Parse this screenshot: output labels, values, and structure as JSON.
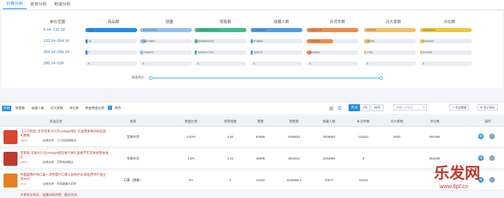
{
  "tabs": [
    "价格分析",
    "类目分析",
    "地域分析"
  ],
  "stats": {
    "headers": [
      "单价范围",
      "商品数",
      "销量",
      "销售额",
      "收藏人数",
      "补货件数",
      "问大家数",
      "评论数"
    ],
    "colors": [
      "#1f8fe6",
      "#8dc3ef",
      "#3bbf8f",
      "#4aa0e0",
      "#f08a4b",
      "#f5c063",
      "#f3c53a"
    ],
    "rows": [
      {
        "range": "0.14~132.14",
        "values": [
          "708",
          "114422318",
          "101986677401.5",
          "17668380",
          "14801175",
          "369910",
          "48380644"
        ],
        "pct": [
          1,
          1,
          1,
          1,
          1,
          1,
          1
        ]
      },
      {
        "range": "132.14~264.14",
        "values": [
          "10",
          "11674860",
          "545583824.5",
          "673850",
          "7716470",
          "45761",
          "3591533"
        ],
        "pct": [
          0.02,
          0.12,
          0.06,
          0.04,
          0.52,
          0.12,
          0.07
        ]
      },
      {
        "range": "264.14~396.14",
        "values": [
          "7",
          "7334572",
          "159519774.9",
          "154770",
          "1542644",
          "1761",
          "591853"
        ],
        "pct": [
          0.01,
          0.06,
          0.02,
          0.01,
          0.1,
          0.005,
          0.01
        ]
      },
      {
        "range": "396.14~520",
        "values": [
          "0",
          "0",
          "0",
          "0",
          "0",
          "0",
          "0"
        ],
        "pct": [
          0,
          0,
          0,
          0,
          0,
          0,
          0
        ]
      }
    ],
    "slider_label": "商品单价"
  },
  "toolbar": {
    "filters": [
      "热销",
      "销量数",
      "收藏人数",
      "问大家数",
      "评论数",
      "佣金佣金比例"
    ],
    "active_filter": 0,
    "sort_label": "降序",
    "ranges": [
      "昨日",
      "7天",
      "30天"
    ],
    "active_range": 0,
    "search_placeholder": "请输入关键词",
    "export_label": "导出数据",
    "fields_label": "显示指标"
  },
  "table": {
    "columns": [
      "商品信息",
      "类目",
      "佣金比例",
      "周转指数",
      "销量",
      "销售额",
      "收藏人数",
      "补货件数",
      "问大家数",
      "评论数",
      "操作"
    ],
    "rows": [
      {
        "thumb": "#d9452f",
        "title": "【三只松鼠_年货坚果大礼包1498g/8袋】礼盒零食休闲食品送礼整箱",
        "price": "168.0",
        "shop": "店铺名称：三只松鼠旗舰店",
        "cells": [
          "坚果炒货",
          "4.51%",
          "4.92",
          "82585",
          "9165601",
          "3048862",
          "131511",
          "4520",
          "694186"
        ]
      },
      {
        "thumb": "#c0392b",
        "title": "百草味-坚果大礼包1600g/9袋坚果干果礼盒春节年货休闲零食送礼",
        "price": "188.0",
        "shop": "店铺名称：百草味旗舰店",
        "cells": [
          "坚果炒货",
          "4.5%",
          "4.41",
          "45898",
          "4911912",
          "2164989",
          "0",
          "",
          "563188"
        ]
      },
      {
        "thumb": "#e67e22",
        "title": "界面面两外粉口喜一次性面片口罩三层防护(k)非医用单片独立装50只",
        "price": "19.9",
        "shop": "店铺名称：阿里健康大药房",
        "cells": [
          "口罩（健康）",
          "0%",
          "0",
          "41297",
          "1045969.3",
          "75577",
          "43443",
          "",
          ""
        ]
      }
    ],
    "tail_title": "大希布头布彩，直播间布的鞋，最近房间"
  },
  "watermark": {
    "text": "乐发网",
    "sub": "www.6pf.cn"
  }
}
